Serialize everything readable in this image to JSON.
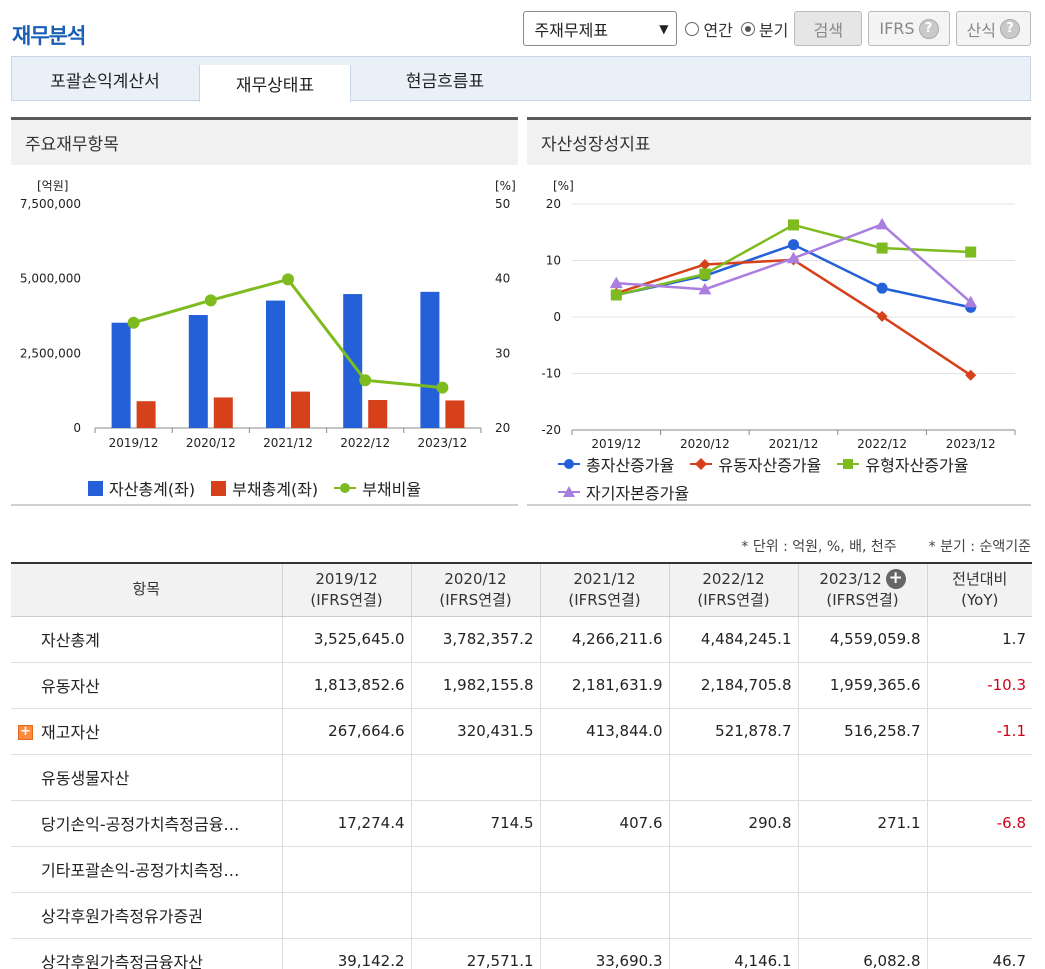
{
  "page": {
    "title": "재무분석"
  },
  "controls": {
    "report_select": "주재무제표",
    "period_annual": "연간",
    "period_quarter": "분기",
    "search": "검색",
    "ifrs": "IFRS",
    "formula": "산식",
    "selected_period": "분기"
  },
  "tabs": [
    {
      "label": "포괄손익계산서",
      "active": false
    },
    {
      "label": "재무상태표",
      "active": true
    },
    {
      "label": "현금흐름표",
      "active": false
    }
  ],
  "left_panel": {
    "title": "주요재무항목",
    "legend": [
      "자산총계(좌)",
      "부채총계(좌)",
      "부채비율"
    ]
  },
  "right_panel": {
    "title": "자산성장성지표",
    "legend": [
      "총자산증가율",
      "유동자산증가율",
      "유형자산증가율",
      "자기자본증가율"
    ]
  },
  "chart_data": [
    {
      "type": "bar",
      "categories": [
        "2019/12",
        "2020/12",
        "2021/12",
        "2022/12",
        "2023/12"
      ],
      "y_left_label": "[억원]",
      "y_right_label": "[%]",
      "y_left_ticks": [
        "7,500,000",
        "5,000,000",
        "2,500,000",
        "0"
      ],
      "y_right_ticks": [
        "50",
        "40",
        "30",
        "20"
      ],
      "ylim_left": [
        0,
        7500000
      ],
      "ylim_right": [
        20,
        50
      ],
      "series": [
        {
          "name": "자산총계(좌)",
          "axis": "left",
          "kind": "bar",
          "color": "#2460d8",
          "values": [
            3525645.0,
            3782357.2,
            4266211.6,
            4484245.1,
            4559059.8
          ]
        },
        {
          "name": "부채총계(좌)",
          "axis": "left",
          "kind": "bar",
          "color": "#d6401a",
          "values": [
            896841,
            1022877,
            1219212,
            936749,
            922281
          ]
        },
        {
          "name": "부채비율",
          "axis": "right",
          "kind": "line",
          "color": "#7dbb1e",
          "values": [
            34.1,
            37.1,
            39.9,
            26.4,
            25.4
          ]
        }
      ]
    },
    {
      "type": "line",
      "categories": [
        "2019/12",
        "2020/12",
        "2021/12",
        "2022/12",
        "2023/12"
      ],
      "y_label": "[%]",
      "y_ticks": [
        "20",
        "10",
        "0",
        "-10",
        "-20"
      ],
      "ylim": [
        -20,
        20
      ],
      "series": [
        {
          "name": "총자산증가율",
          "color": "#2460d8",
          "marker": "circle",
          "values": [
            3.9,
            7.3,
            12.8,
            5.1,
            1.7
          ]
        },
        {
          "name": "유동자산증가율",
          "color": "#d6401a",
          "marker": "diamond",
          "values": [
            4.2,
            9.3,
            10.1,
            0.1,
            -10.3
          ]
        },
        {
          "name": "유형자산증가율",
          "color": "#7dbb1e",
          "marker": "square",
          "values": [
            3.9,
            7.6,
            16.3,
            12.2,
            11.5
          ]
        },
        {
          "name": "자기자본증가율",
          "color": "#a97ee0",
          "marker": "triangle",
          "values": [
            6.0,
            4.9,
            10.4,
            16.4,
            2.6
          ]
        }
      ]
    }
  ],
  "notes": [
    "* 단위 : 억원, %, 배, 천주",
    "* 분기 : 순액기준"
  ],
  "table": {
    "headers": [
      {
        "line1": "항목",
        "line2": ""
      },
      {
        "line1": "2019/12",
        "line2": "(IFRS연결)"
      },
      {
        "line1": "2020/12",
        "line2": "(IFRS연결)"
      },
      {
        "line1": "2021/12",
        "line2": "(IFRS연결)"
      },
      {
        "line1": "2022/12",
        "line2": "(IFRS연결)"
      },
      {
        "line1": "2023/12",
        "line2": "(IFRS연결)"
      },
      {
        "line1": "전년대비",
        "line2": "(YoY)"
      }
    ],
    "rows": [
      {
        "label": "자산총계",
        "values": [
          "3,525,645.0",
          "3,782,357.2",
          "4,266,211.6",
          "4,484,245.1",
          "4,559,059.8",
          "1.7"
        ],
        "expandable": false,
        "yoy_negative": false
      },
      {
        "label": "유동자산",
        "values": [
          "1,813,852.6",
          "1,982,155.8",
          "2,181,631.9",
          "2,184,705.8",
          "1,959,365.6",
          "-10.3"
        ],
        "expandable": false,
        "yoy_negative": true
      },
      {
        "label": "재고자산",
        "values": [
          "267,664.6",
          "320,431.5",
          "413,844.0",
          "521,878.7",
          "516,258.7",
          "-1.1"
        ],
        "expandable": true,
        "yoy_negative": true
      },
      {
        "label": "유동생물자산",
        "values": [
          "",
          "",
          "",
          "",
          "",
          ""
        ],
        "expandable": false,
        "yoy_negative": false
      },
      {
        "label": "당기손익-공정가치측정금융…",
        "values": [
          "17,274.4",
          "714.5",
          "407.6",
          "290.8",
          "271.1",
          "-6.8"
        ],
        "expandable": false,
        "yoy_negative": true
      },
      {
        "label": "기타포괄손익-공정가치측정…",
        "values": [
          "",
          "",
          "",
          "",
          "",
          ""
        ],
        "expandable": false,
        "yoy_negative": false
      },
      {
        "label": "상각후원가측정유가증권",
        "values": [
          "",
          "",
          "",
          "",
          "",
          ""
        ],
        "expandable": false,
        "yoy_negative": false
      },
      {
        "label": "상각후원가측정금융자산",
        "values": [
          "39,142.2",
          "27,571.1",
          "33,690.3",
          "4,146.1",
          "6,082.8",
          "46.7"
        ],
        "expandable": false,
        "yoy_negative": false
      }
    ]
  }
}
